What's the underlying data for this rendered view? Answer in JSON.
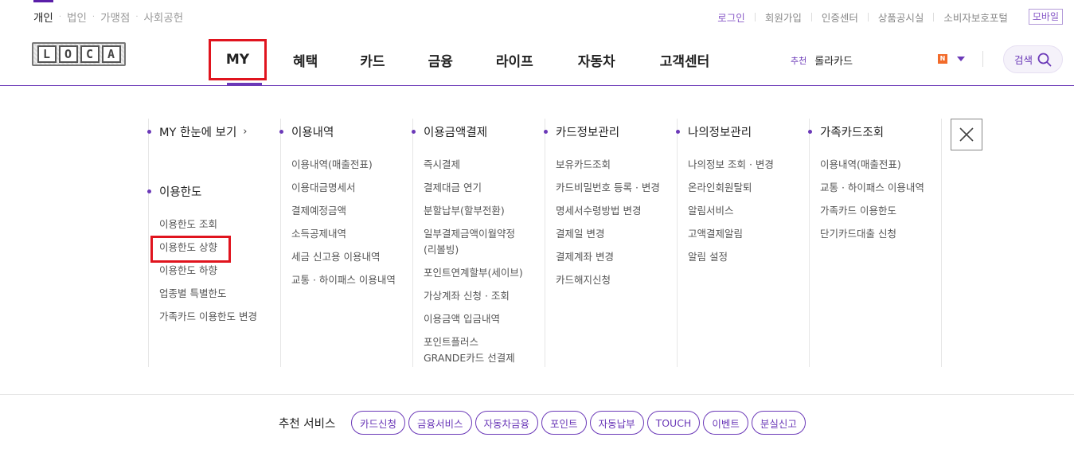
{
  "segments": [
    "개인",
    "법인",
    "가맹점",
    "사회공헌"
  ],
  "utility": {
    "login": "로그인",
    "join": "회원가입",
    "cert": "인증센터",
    "notice": "상품공시실",
    "consumer": "소비자보호포털",
    "mobile": "모바일"
  },
  "logo": {
    "letters": [
      "L",
      "O",
      "C",
      "A"
    ]
  },
  "gnb": [
    "MY",
    "혜택",
    "카드",
    "금융",
    "라이프",
    "자동차",
    "고객센터"
  ],
  "recommend": {
    "tag": "추천",
    "word": "롤라카드"
  },
  "lang_badge": "N",
  "search_label": "검색",
  "menu": {
    "c1": {
      "head": "MY 한눈에 보기",
      "head2": "이용한도",
      "items2": [
        "이용한도 조회",
        "이용한도 상향",
        "이용한도 하향",
        "업종별 특별한도",
        "가족카드 이용한도 변경"
      ]
    },
    "c2": {
      "head": "이용내역",
      "items": [
        "이용내역(매출전표)",
        "이용대금명세서",
        "결제예정금액",
        "소득공제내역",
        "세금 신고용 이용내역",
        "교통 · 하이패스 이용내역"
      ]
    },
    "c3": {
      "head": "이용금액결제",
      "items": [
        "즉시결제",
        "결제대금 연기",
        "분할납부(할부전환)",
        "일부결제금액이월약정",
        "(리볼빙)",
        "포인트연계할부(세이브)",
        "가상계좌 신청 · 조회",
        "이용금액 입금내역",
        "포인트플러스",
        "GRANDE카드 선결제"
      ]
    },
    "c4": {
      "head": "카드정보관리",
      "items": [
        "보유카드조회",
        "카드비밀번호 등록 · 변경",
        "명세서수령방법 변경",
        "결제일 변경",
        "결제계좌 변경",
        "카드해지신청"
      ]
    },
    "c5": {
      "head": "나의정보관리",
      "items": [
        "나의정보 조회 · 변경",
        "온라인회원탈퇴",
        "알림서비스",
        "고액결제알림",
        "알림 설정"
      ]
    },
    "c6": {
      "head": "가족카드조회",
      "items": [
        "이용내역(매출전표)",
        "교통 · 하이패스 이용내역",
        "가족카드 이용한도",
        "단기카드대출 신청"
      ]
    }
  },
  "footer": {
    "label": "추천 서비스",
    "chips": [
      "카드신청",
      "금융서비스",
      "자동차금융",
      "포인트",
      "자동납부",
      "TOUCH",
      "이벤트",
      "분실신고"
    ]
  },
  "colors": {
    "accent": "#6b39b8",
    "highlight": "#e0141e"
  }
}
